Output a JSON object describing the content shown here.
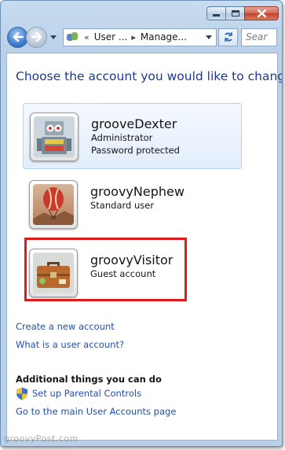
{
  "window": {
    "buttons": {
      "minimize": "minimize-icon",
      "maximize": "maximize-icon",
      "close": "close-icon"
    }
  },
  "navbar": {
    "breadcrumbs": [
      "User ...",
      "Manage..."
    ],
    "breadcrumb_prefix": "«",
    "search_placeholder": "Sear"
  },
  "content": {
    "heading": "Choose the account you would like to change",
    "accounts": [
      {
        "name": "grooveDexter",
        "lines": [
          "Administrator",
          "Password protected"
        ],
        "picture": "robot-toy",
        "selected": true
      },
      {
        "name": "groovyNephew",
        "lines": [
          "Standard user"
        ],
        "picture": "hot-air-balloon",
        "selected": false
      },
      {
        "name": "groovyVisitor",
        "lines": [
          "Guest account"
        ],
        "picture": "briefcase",
        "selected": false
      }
    ],
    "links": {
      "create": "Create a new account",
      "what_is": "What is a user account?"
    },
    "additional": {
      "heading": "Additional things you can do",
      "parental": "Set up Parental Controls",
      "main_page": "Go to the main User Accounts page"
    }
  },
  "colors": {
    "heading": "#1e3b8a",
    "link": "#1f4fb0",
    "highlight": "#e01a1a"
  },
  "watermark": "groovyPost.com"
}
